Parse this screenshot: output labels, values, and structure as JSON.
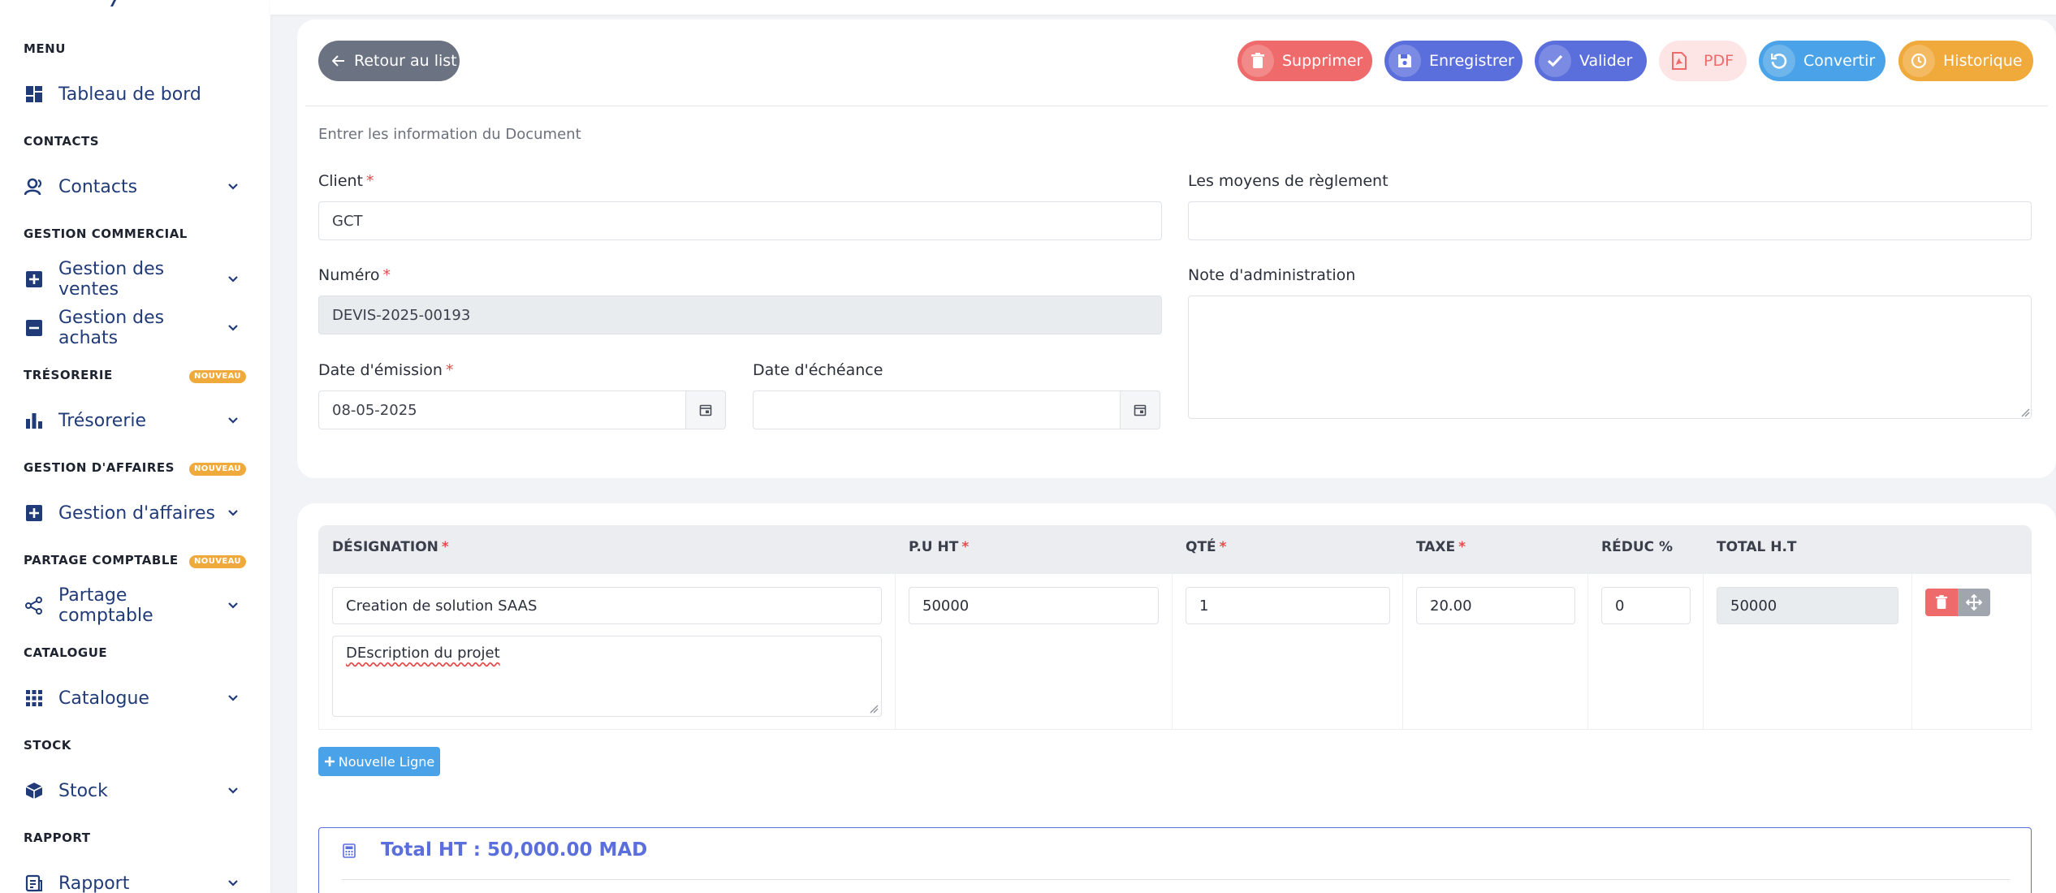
{
  "sidebar": {
    "sections": [
      {
        "title": "MENU"
      },
      {
        "title": "CONTACTS"
      },
      {
        "title": "GESTION COMMERCIAL"
      },
      {
        "title": "TRÉSORERIE",
        "badge": "NOUVEAU"
      },
      {
        "title": "GESTION D'AFFAIRES",
        "badge": "NOUVEAU"
      },
      {
        "title": "PARTAGE COMPTABLE",
        "badge": "NOUVEAU"
      },
      {
        "title": "CATALOGUE"
      },
      {
        "title": "STOCK"
      },
      {
        "title": "RAPPORT"
      }
    ],
    "items": [
      {
        "label": "Tableau de bord",
        "icon": "dashboard-icon"
      },
      {
        "label": "Contacts",
        "icon": "users-icon"
      },
      {
        "label": "Gestion des ventes",
        "icon": "plus-square-icon"
      },
      {
        "label": "Gestion des achats",
        "icon": "minus-square-icon"
      },
      {
        "label": "Trésorerie",
        "icon": "bar-chart-icon"
      },
      {
        "label": "Gestion d'affaires",
        "icon": "plus-square-icon"
      },
      {
        "label": "Partage comptable",
        "icon": "share-icon"
      },
      {
        "label": "Catalogue",
        "icon": "grid-icon"
      },
      {
        "label": "Stock",
        "icon": "box-icon"
      },
      {
        "label": "Rapport",
        "icon": "report-icon"
      }
    ]
  },
  "toolbar": {
    "back_label": "Retour au list",
    "delete_label": "Supprimer",
    "save_label": "Enregistrer",
    "validate_label": "Valider",
    "pdf_label": "PDF",
    "convert_label": "Convertir",
    "history_label": "Historique"
  },
  "form": {
    "intro": "Entrer les information du Document",
    "client_label": "Client",
    "client_value": "GCT",
    "payment_label": "Les moyens de règlement",
    "payment_value": "",
    "number_label": "Numéro",
    "number_value": "DEVIS-2025-00193",
    "note_label": "Note d'administration",
    "note_value": "",
    "issue_date_label": "Date d'émission",
    "issue_date_value": "08-05-2025",
    "due_date_label": "Date d'échéance",
    "due_date_value": "",
    "required_mark": "*"
  },
  "lines": {
    "headers": {
      "designation": "DÉSIGNATION",
      "pu": "P.U HT",
      "qty": "QTÉ",
      "tax": "TAXE",
      "discount": "RÉDUC %",
      "total": "TOTAL H.T"
    },
    "rows": [
      {
        "designation": "Creation de solution SAAS",
        "description": "DEscription du projet",
        "pu": "50000",
        "qty": "1",
        "tax": "20.00",
        "discount": "0",
        "total": "50000"
      }
    ],
    "add_label": "Nouvelle Ligne"
  },
  "totals": {
    "total_ht": "Total HT : 50,000.00 MAD"
  },
  "colors": {
    "primary": "#5b6fdc",
    "danger": "#ef6a6a",
    "info": "#4aa3e8",
    "warning": "#f0a93b",
    "navy": "#213b79"
  }
}
